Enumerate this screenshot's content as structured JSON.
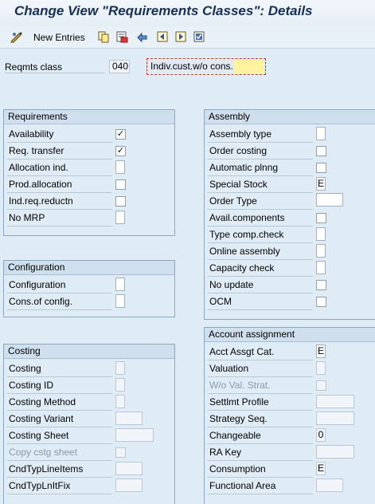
{
  "header": {
    "title": "Change View \"Requirements Classes\": Details"
  },
  "toolbar": {
    "new_entries_label": "New Entries",
    "icons": [
      "display-change-icon",
      "copy-icon",
      "delete-icon",
      "undo-icon",
      "previous-entry-icon",
      "next-entry-icon",
      "select-all-icon"
    ]
  },
  "reqmts": {
    "label": "Reqmts class",
    "value": "040",
    "description": "Indiv.cust.w/o cons."
  },
  "requirements": {
    "title": "Requirements",
    "availability": {
      "label": "Availability",
      "checked": true
    },
    "req_transfer": {
      "label": "Req. transfer",
      "checked": true
    },
    "allocation_ind": {
      "label": "Allocation ind.",
      "value": ""
    },
    "prod_allocation": {
      "label": "Prod.allocation",
      "checked": false
    },
    "ind_req_reductn": {
      "label": "Ind.req.reductn",
      "checked": false
    },
    "no_mrp": {
      "label": "No MRP",
      "value": ""
    }
  },
  "configuration": {
    "title": "Configuration",
    "configuration": {
      "label": "Configuration",
      "value": ""
    },
    "cons_of_config": {
      "label": "Cons.of config.",
      "value": ""
    }
  },
  "costing": {
    "title": "Costing",
    "costing": {
      "label": "Costing",
      "value": ""
    },
    "costing_id": {
      "label": "Costing ID",
      "value": ""
    },
    "costing_method": {
      "label": "Costing Method",
      "value": ""
    },
    "costing_variant": {
      "label": "Costing Variant",
      "value": ""
    },
    "costing_sheet": {
      "label": "Costing Sheet",
      "value": ""
    },
    "copy_cstg_sheet": {
      "label": "Copy cstg sheet",
      "checked": false
    },
    "cndtyp_line_items": {
      "label": "CndTypLineItems",
      "value": ""
    },
    "cndtyp_lnit_fix": {
      "label": "CndTypLnItFix",
      "value": ""
    }
  },
  "assembly": {
    "title": "Assembly",
    "assembly_type": {
      "label": "Assembly type",
      "value": ""
    },
    "order_costing": {
      "label": "Order costing",
      "checked": false
    },
    "automatic_plnng": {
      "label": "Automatic plnng",
      "checked": false
    },
    "special_stock": {
      "label": "Special Stock",
      "value": "E"
    },
    "order_type": {
      "label": "Order Type",
      "value": ""
    },
    "avail_components": {
      "label": "Avail.components",
      "checked": false
    },
    "type_comp_check": {
      "label": "Type comp.check",
      "value": ""
    },
    "online_assembly": {
      "label": "Online assembly",
      "value": ""
    },
    "capacity_check": {
      "label": "Capacity check",
      "value": ""
    },
    "no_update": {
      "label": "No update",
      "checked": false
    },
    "ocm": {
      "label": "OCM",
      "checked": false
    }
  },
  "account_assignment": {
    "title": "Account assignment",
    "acct_assgt_cat": {
      "label": "Acct Assgt Cat.",
      "value": "E"
    },
    "valuation": {
      "label": "Valuation",
      "value": ""
    },
    "wo_val_strat": {
      "label": "W/o Val. Strat.",
      "checked": false
    },
    "settlmt_profile": {
      "label": "Settlmt Profile",
      "value": ""
    },
    "strategy_seq": {
      "label": "Strategy Seq.",
      "value": ""
    },
    "changeable": {
      "label": "Changeable",
      "value": "0"
    },
    "ra_key": {
      "label": "RA Key",
      "value": ""
    },
    "consumption": {
      "label": "Consumption",
      "value": "E"
    },
    "functional_area": {
      "label": "Functional Area",
      "value": ""
    }
  }
}
